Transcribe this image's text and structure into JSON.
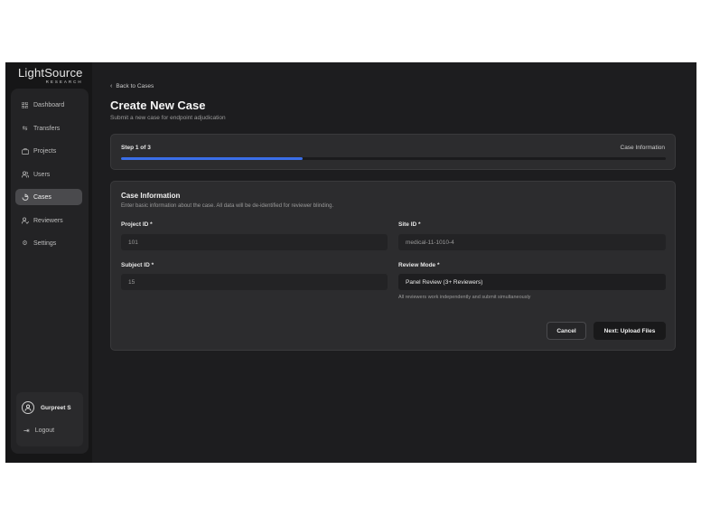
{
  "brand": {
    "name": "LightSource",
    "tagline": "RESEARCH"
  },
  "sidebar": {
    "items": [
      {
        "label": "Dashboard",
        "icon": "grid-icon",
        "active": false
      },
      {
        "label": "Transfers",
        "icon": "transfer-icon",
        "active": false
      },
      {
        "label": "Projects",
        "icon": "briefcase-icon",
        "active": false
      },
      {
        "label": "Users",
        "icon": "users-icon",
        "active": false
      },
      {
        "label": "Cases",
        "icon": "case-icon",
        "active": true
      },
      {
        "label": "Reviewers",
        "icon": "reviewer-icon",
        "active": false
      },
      {
        "label": "Settings",
        "icon": "gear-icon",
        "active": false
      }
    ],
    "user": {
      "name": "Gurpreet S"
    },
    "logout_label": "Logout"
  },
  "page": {
    "back_label": "Back to Cases",
    "title": "Create New Case",
    "subtitle": "Submit a new case for endpoint adjudication"
  },
  "stepper": {
    "step_label": "Step 1 of 3",
    "step_name": "Case Information",
    "progress": 0.333,
    "accent": "#3a6ee8"
  },
  "form": {
    "title": "Case Information",
    "description": "Enter basic information about the case. All data will be de-identified for reviewer blinding.",
    "fields": {
      "project_id": {
        "label": "Project ID *",
        "value": "101"
      },
      "site_id": {
        "label": "Site ID *",
        "value": "medical-11-1010-4"
      },
      "subject_id": {
        "label": "Subject ID *",
        "value": "15"
      },
      "review_mode": {
        "label": "Review Mode *",
        "value": "Panel Review (3+ Reviewers)",
        "hint": "All reviewers work independently and submit simultaneously"
      }
    },
    "cancel_label": "Cancel",
    "next_label": "Next: Upload Files"
  }
}
